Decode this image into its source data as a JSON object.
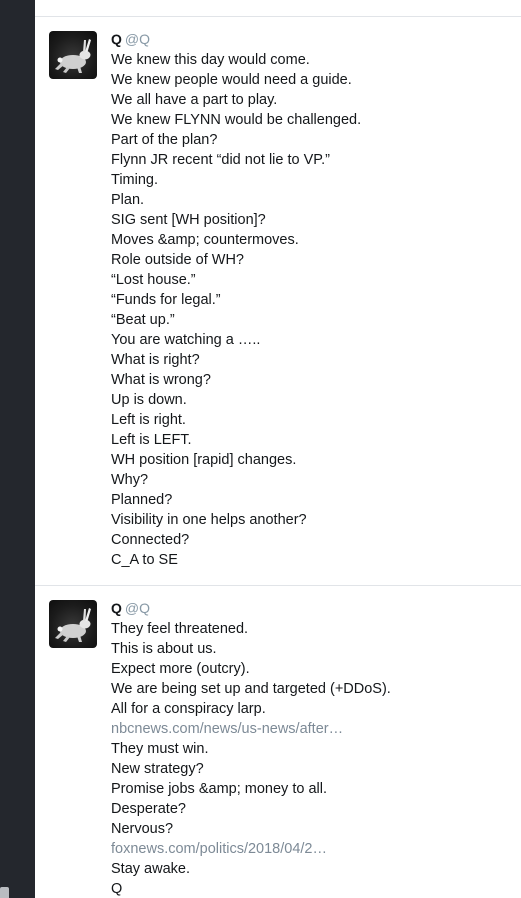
{
  "posts": [
    {
      "author_name": "Q",
      "author_handle": "@Q",
      "lines": [
        {
          "text": "We knew this day would come.",
          "is_link": false
        },
        {
          "text": "We knew people would need a guide.",
          "is_link": false
        },
        {
          "text": "We all have a part to play.",
          "is_link": false
        },
        {
          "text": "We knew FLYNN would be challenged.",
          "is_link": false
        },
        {
          "text": "Part of the plan?",
          "is_link": false
        },
        {
          "text": "Flynn JR recent “did not lie to VP.”",
          "is_link": false
        },
        {
          "text": "Timing.",
          "is_link": false
        },
        {
          "text": "Plan.",
          "is_link": false
        },
        {
          "text": "SIG sent [WH position]?",
          "is_link": false
        },
        {
          "text": "Moves &amp; countermoves.",
          "is_link": false
        },
        {
          "text": "Role outside of WH?",
          "is_link": false
        },
        {
          "text": "“Lost house.”",
          "is_link": false
        },
        {
          "text": "“Funds for legal.”",
          "is_link": false
        },
        {
          "text": "“Beat up.”",
          "is_link": false
        },
        {
          "text": "You are watching a …..",
          "is_link": false
        },
        {
          "text": "What is right?",
          "is_link": false
        },
        {
          "text": "What is wrong?",
          "is_link": false
        },
        {
          "text": "Up is down.",
          "is_link": false
        },
        {
          "text": "Left is right.",
          "is_link": false
        },
        {
          "text": "Left is LEFT.",
          "is_link": false
        },
        {
          "text": "WH position [rapid] changes.",
          "is_link": false
        },
        {
          "text": "Why?",
          "is_link": false
        },
        {
          "text": "Planned?",
          "is_link": false
        },
        {
          "text": "Visibility in one helps another?",
          "is_link": false
        },
        {
          "text": "Connected?",
          "is_link": false
        },
        {
          "text": "C_A to SE",
          "is_link": false
        }
      ]
    },
    {
      "author_name": "Q",
      "author_handle": "@Q",
      "lines": [
        {
          "text": "They feel threatened.",
          "is_link": false
        },
        {
          "text": "This is about us.",
          "is_link": false
        },
        {
          "text": "Expect more (outcry).",
          "is_link": false
        },
        {
          "text": "We are being set up and targeted (+DDoS).",
          "is_link": false
        },
        {
          "text": "All for a conspiracy larp.",
          "is_link": false
        },
        {
          "text": "nbcnews.com/news/us-news/after…",
          "is_link": true
        },
        {
          "text": "They must win.",
          "is_link": false
        },
        {
          "text": "New strategy?",
          "is_link": false
        },
        {
          "text": "Promise jobs &amp; money to all.",
          "is_link": false
        },
        {
          "text": "Desperate?",
          "is_link": false
        },
        {
          "text": "Nervous?",
          "is_link": false
        },
        {
          "text": "foxnews.com/politics/2018/04/2…",
          "is_link": true
        },
        {
          "text": "Stay awake.",
          "is_link": false
        },
        {
          "text": "Q",
          "is_link": false
        }
      ]
    }
  ],
  "icons": {
    "avatar": "rabbit-avatar-icon"
  },
  "colors": {
    "sidebar": "#24272d",
    "text": "#14171a",
    "handle": "#8899a6",
    "link": "#7d8a96",
    "divider": "#e1e4e8"
  }
}
